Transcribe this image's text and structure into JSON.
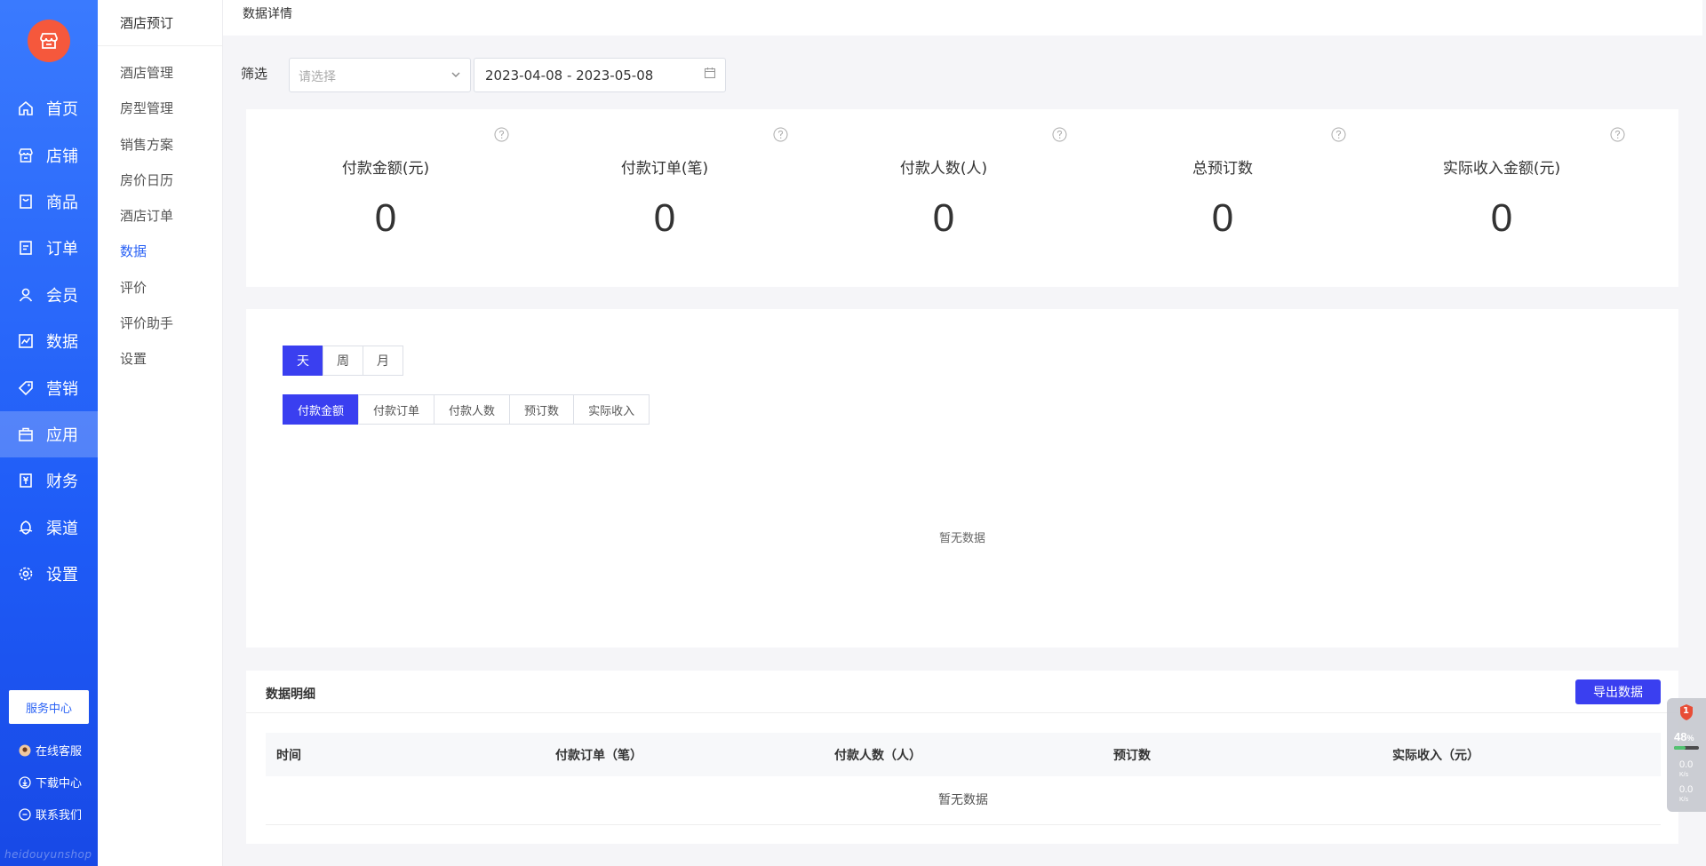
{
  "sidebar": {
    "items": [
      {
        "label": "首页",
        "icon": "home-icon"
      },
      {
        "label": "店铺",
        "icon": "store-icon"
      },
      {
        "label": "商品",
        "icon": "goods-icon"
      },
      {
        "label": "订单",
        "icon": "order-icon"
      },
      {
        "label": "会员",
        "icon": "member-icon"
      },
      {
        "label": "数据",
        "icon": "chart-icon"
      },
      {
        "label": "营销",
        "icon": "tag-icon"
      },
      {
        "label": "应用",
        "icon": "app-icon"
      },
      {
        "label": "财务",
        "icon": "finance-icon"
      },
      {
        "label": "渠道",
        "icon": "channel-icon"
      },
      {
        "label": "设置",
        "icon": "gear-icon"
      }
    ],
    "active": "应用",
    "service_center": "服务中心",
    "online_support": "在线客服",
    "download_center": "下载中心",
    "contact_us": "联系我们",
    "watermark": "heidouyunshop"
  },
  "subnav": {
    "title": "酒店预订",
    "items": [
      "酒店管理",
      "房型管理",
      "销售方案",
      "房价日历",
      "酒店订单",
      "数据",
      "评价",
      "评价助手",
      "设置"
    ],
    "active": "数据"
  },
  "page": {
    "title": "数据详情",
    "filter_label": "筛选",
    "select_placeholder": "请选择",
    "date_range": "2023-04-08 - 2023-05-08"
  },
  "stats": [
    {
      "label": "付款金额(元)",
      "value": "0"
    },
    {
      "label": "付款订单(笔)",
      "value": "0"
    },
    {
      "label": "付款人数(人)",
      "value": "0"
    },
    {
      "label": "总预订数",
      "value": "0"
    },
    {
      "label": "实际收入金额(元)",
      "value": "0"
    }
  ],
  "chart_panel": {
    "period_tabs": [
      "天",
      "周",
      "月"
    ],
    "period_active": "天",
    "metric_tabs": [
      "付款金额",
      "付款订单",
      "付款人数",
      "预订数",
      "实际收入"
    ],
    "metric_active": "付款金额",
    "empty_text": "暂无数据"
  },
  "detail": {
    "title": "数据明细",
    "export_label": "导出数据",
    "columns": [
      "时间",
      "付款订单（笔）",
      "付款人数（人）",
      "预订数",
      "实际收入（元）"
    ],
    "empty_text": "暂无数据"
  },
  "widget": {
    "badge": "1",
    "cpu_percent": "48",
    "cpu_unit": "%",
    "up_speed": "0.0",
    "down_speed": "0.0",
    "speed_unit": "K/s"
  },
  "colors": {
    "sidebar": "#2563f6",
    "primary": "#3a3ff0",
    "logo": "#f5583c",
    "link_active": "#2a62f5"
  }
}
